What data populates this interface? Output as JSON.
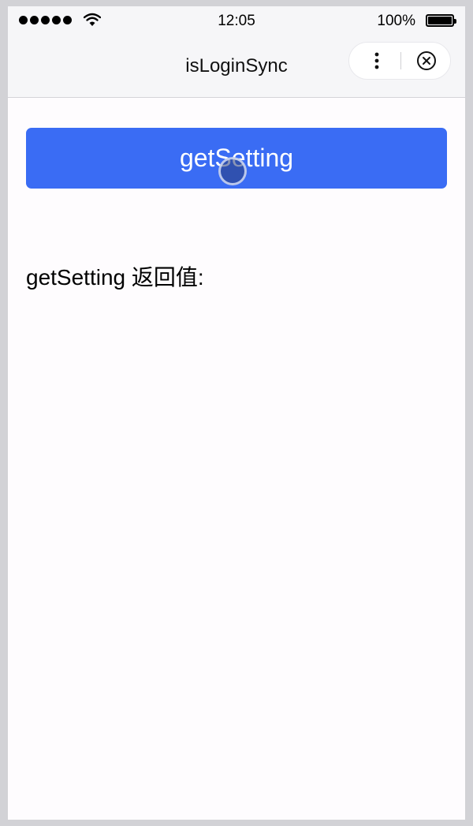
{
  "status_bar": {
    "time": "12:05",
    "battery_percent": "100%",
    "signal_icon": "signal-dots-icon",
    "wifi_icon": "wifi-icon",
    "battery_icon": "battery-icon"
  },
  "nav": {
    "title": "isLoginSync",
    "more_icon": "more-vertical-icon",
    "close_icon": "close-circle-icon"
  },
  "main": {
    "button_label": "getSetting",
    "result_label": "getSetting 返回值:"
  },
  "colors": {
    "button": "#3a6cf4",
    "nav_background": "#f6f6f8",
    "content_background": "#fefcfe"
  }
}
